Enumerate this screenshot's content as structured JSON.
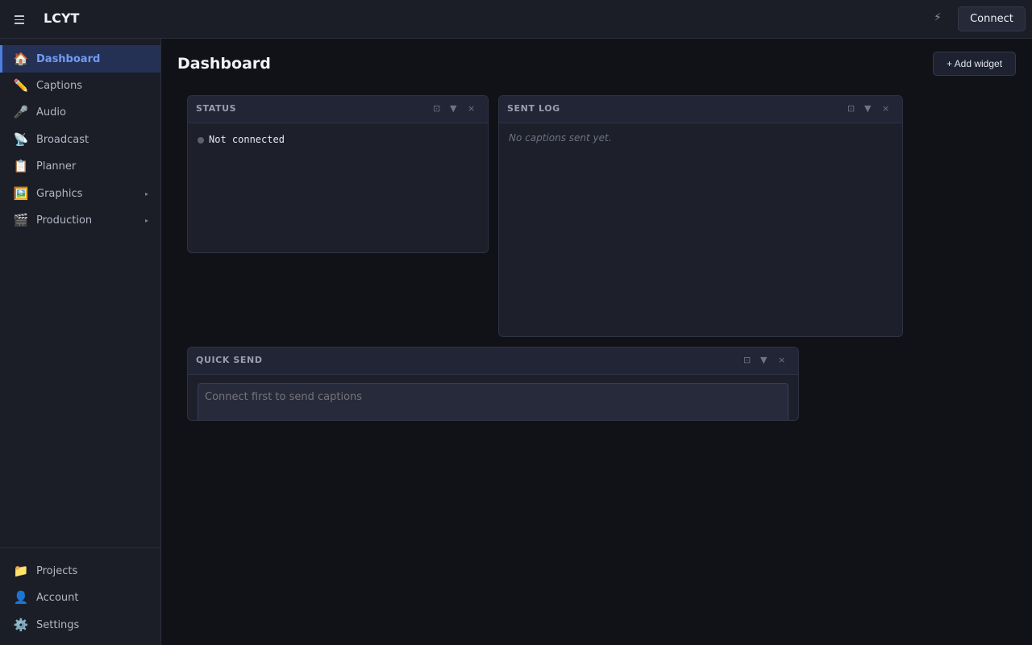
{
  "app": {
    "title": "LCYT"
  },
  "topbar": {
    "connect_label": "Connect",
    "bolt_icon": "⚡"
  },
  "sidebar": {
    "items": [
      {
        "label": "Dashboard",
        "icon": "🏠",
        "active": true
      },
      {
        "label": "Captions",
        "icon": "✏️"
      },
      {
        "label": "Audio",
        "icon": "🎤"
      },
      {
        "label": "Broadcast",
        "icon": "📡"
      },
      {
        "label": "Planner",
        "icon": "📋"
      },
      {
        "label": "Graphics",
        "icon": "🖼️",
        "caret": "▸"
      },
      {
        "label": "Production",
        "icon": "🎬",
        "caret": "▸"
      }
    ],
    "bottom_items": [
      {
        "label": "Projects",
        "icon": "📁"
      },
      {
        "label": "Account",
        "icon": "👤"
      },
      {
        "label": "Settings",
        "icon": "⚙️"
      }
    ]
  },
  "main": {
    "title": "Dashboard",
    "add_widget_label": "+ Add widget"
  },
  "widgets": {
    "controls": {
      "pin": "⊡",
      "collapse": "▼",
      "close": "×"
    },
    "status": {
      "title": "STATUS",
      "text": "Not connected"
    },
    "sent_log": {
      "title": "SENT LOG",
      "empty": "No captions sent yet."
    },
    "quick_send": {
      "title": "QUICK SEND",
      "placeholder": "Connect first to send captions"
    }
  },
  "colors": {
    "accent": "#4c7fe0",
    "background": "#111218",
    "panel": "#1d1f2b"
  }
}
